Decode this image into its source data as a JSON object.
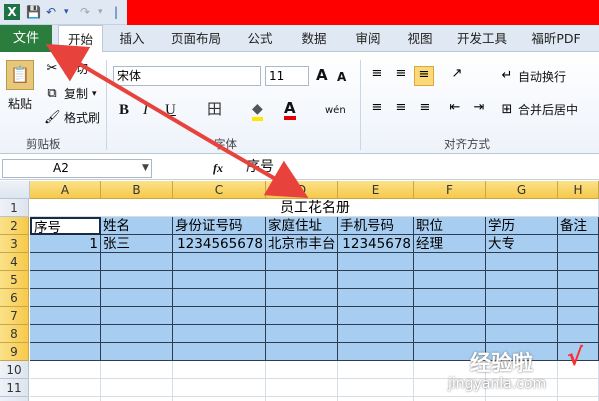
{
  "qat": {
    "glyphs": [
      "X",
      "💾",
      "↶",
      "↷",
      "▾",
      "|"
    ]
  },
  "tabs": [
    {
      "label": "文件"
    },
    {
      "label": "开始"
    },
    {
      "label": "插入"
    },
    {
      "label": "页面布局"
    },
    {
      "label": "公式"
    },
    {
      "label": "数据"
    },
    {
      "label": "审阅"
    },
    {
      "label": "视图"
    },
    {
      "label": "开发工具"
    },
    {
      "label": "福昕PDF"
    }
  ],
  "ribbon": {
    "clipboard": {
      "paste": "粘贴",
      "cut": "剪切",
      "copy": "复制",
      "copy_caret": "▾",
      "format_painter": "格式刷",
      "group": "剪贴板"
    },
    "font": {
      "name": "宋体",
      "size": "11",
      "grow": "A",
      "shrink": "A",
      "bold": "B",
      "italic": "I",
      "underline": "U",
      "borders": "田",
      "fill_color": "◆",
      "font_color": "A",
      "phonetic": "wén",
      "group": "字体"
    },
    "alignment": {
      "wrap": "自动换行",
      "merge": "合并后居中",
      "group": "对齐方式"
    }
  },
  "formula_bar": {
    "name_box": "A2",
    "fx": "fx",
    "value": "序号"
  },
  "sheet": {
    "columns": [
      "A",
      "B",
      "C",
      "D",
      "E",
      "F",
      "G",
      "H"
    ],
    "rows": [
      "1",
      "2",
      "3",
      "4",
      "5",
      "6",
      "7",
      "8",
      "9",
      "10",
      "11",
      "12"
    ],
    "title": "员工花名册",
    "headers": [
      "序号",
      "姓名",
      "身份证号码",
      "家庭住址",
      "手机号码",
      "职位",
      "学历",
      "备注"
    ],
    "row3": [
      "1",
      "张三",
      "1234565678",
      "北京市丰台",
      "12345678",
      "经理",
      "大专",
      ""
    ]
  },
  "watermark": {
    "line1": "经验啦",
    "check": "√",
    "line2": "jingyanla.com"
  },
  "colors": {
    "accent": "#2a7d3d",
    "selection": "#a7cdf0",
    "header_highlight": "#f6c94a",
    "arrow": "#e8423c"
  }
}
